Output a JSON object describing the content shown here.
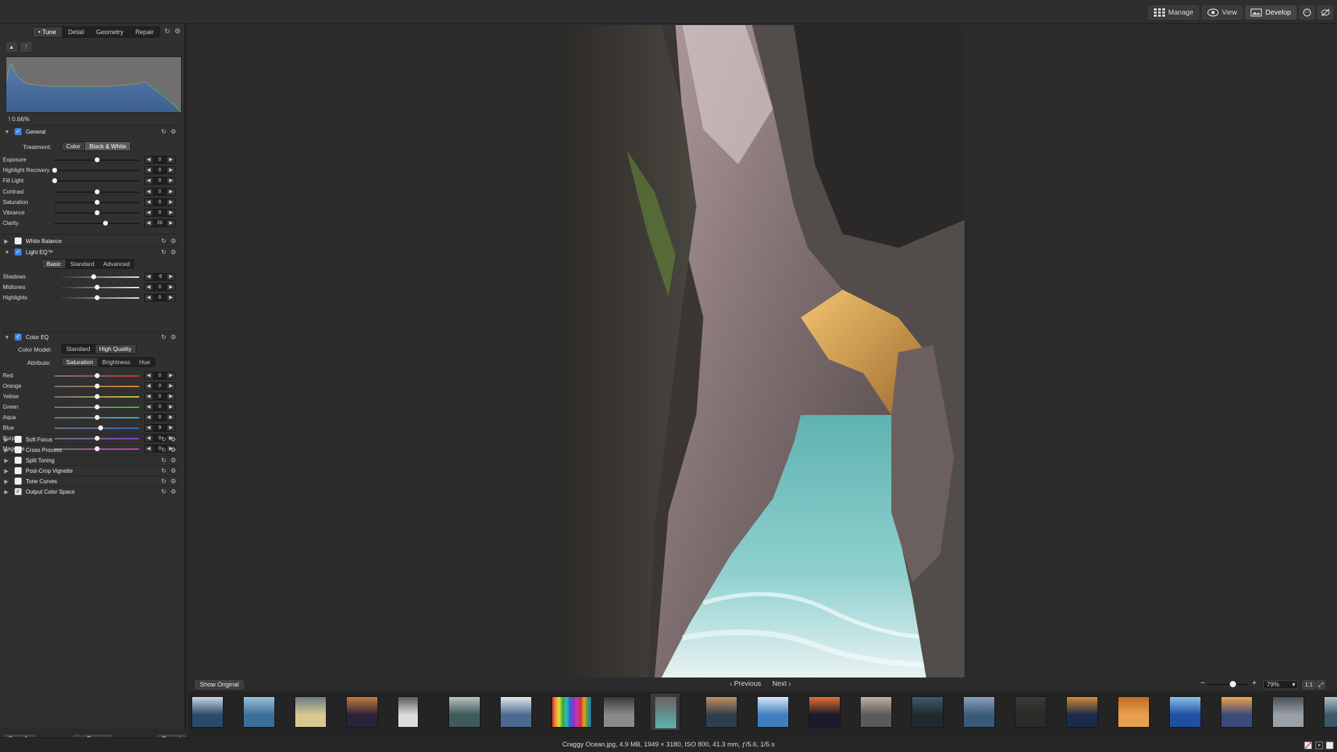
{
  "modes": {
    "manage": "Manage",
    "view": "View",
    "develop": "Develop",
    "manage_icon": "grid-icon",
    "view_icon": "eye-icon",
    "develop_icon": "develop-icon"
  },
  "tabs": [
    "Tune",
    "Detail",
    "Geometry",
    "Repair"
  ],
  "histogram": {
    "clip_value": "0.66%"
  },
  "general": {
    "title": "General",
    "treatment_label": "Treatment:",
    "treatment_options": [
      "Color",
      "Black & White"
    ],
    "sliders": [
      {
        "name": "Exposure",
        "value": "0",
        "level": 0.5
      },
      {
        "name": "Highlight Recovery",
        "value": "0",
        "level": 0
      },
      {
        "name": "Fill Light",
        "value": "0",
        "level": 0
      },
      {
        "name": "Contrast",
        "value": "0",
        "level": 0.5
      },
      {
        "name": "Saturation",
        "value": "0",
        "level": 0.5
      },
      {
        "name": "Vibrance",
        "value": "0",
        "level": 0.5
      },
      {
        "name": "Clarity",
        "value": "20",
        "level": 0.6
      }
    ]
  },
  "white_balance": {
    "title": "White Balance"
  },
  "light_eq": {
    "title": "Light EQ™",
    "modes": [
      "Basic",
      "Standard",
      "Advanced"
    ],
    "sliders": [
      {
        "name": "Shadows",
        "value": "-9",
        "level": 0.46
      },
      {
        "name": "Midtones",
        "value": "0",
        "level": 0.5
      },
      {
        "name": "Highlights",
        "value": "0",
        "level": 0.5
      }
    ]
  },
  "color_eq": {
    "title": "Color EQ",
    "model_label": "Color Model:",
    "models": [
      "Standard",
      "High Quality"
    ],
    "attribute_label": "Attribute:",
    "attributes": [
      "Saturation",
      "Brightness",
      "Hue"
    ],
    "sliders": [
      {
        "name": "Red",
        "value": "0",
        "level": 0.5,
        "color": "#d63a2f"
      },
      {
        "name": "Orange",
        "value": "0",
        "level": 0.5,
        "color": "#e3852a"
      },
      {
        "name": "Yellow",
        "value": "0",
        "level": 0.5,
        "color": "#d7cc2c"
      },
      {
        "name": "Green",
        "value": "0",
        "level": 0.5,
        "color": "#4dbb3a"
      },
      {
        "name": "Aqua",
        "value": "0",
        "level": 0.5,
        "color": "#2fbfb4"
      },
      {
        "name": "Blue",
        "value": "9",
        "level": 0.54,
        "color": "#3a67d8"
      },
      {
        "name": "Purple",
        "value": "0",
        "level": 0.5,
        "color": "#8a43d0"
      },
      {
        "name": "Magenta",
        "value": "0",
        "level": 0.5,
        "color": "#c93fc2"
      }
    ]
  },
  "extra_sections": [
    "Soft Focus",
    "Cross Process",
    "Split Toning",
    "Post-Crop Vignette",
    "Tone Curves",
    "Output Color Space"
  ],
  "footer": {
    "save_as": "Save As",
    "done": "Done",
    "cancel": "Cancel"
  },
  "viewer": {
    "show_original": "Show Original",
    "previous": "Previous",
    "next": "Next",
    "zoom": "79%",
    "one_to_one": "1:1",
    "zoom_minus": "−",
    "zoom_plus": "+",
    "zoom_level": 0.62
  },
  "status": {
    "file_info": "Craggy Ocean.jpg, 4.9 MB, 1949 × 3180, ISO 800, 41.3 mm, ƒ/5.6, 1/5 s"
  },
  "colors": {
    "accent": "#3a83e6"
  }
}
